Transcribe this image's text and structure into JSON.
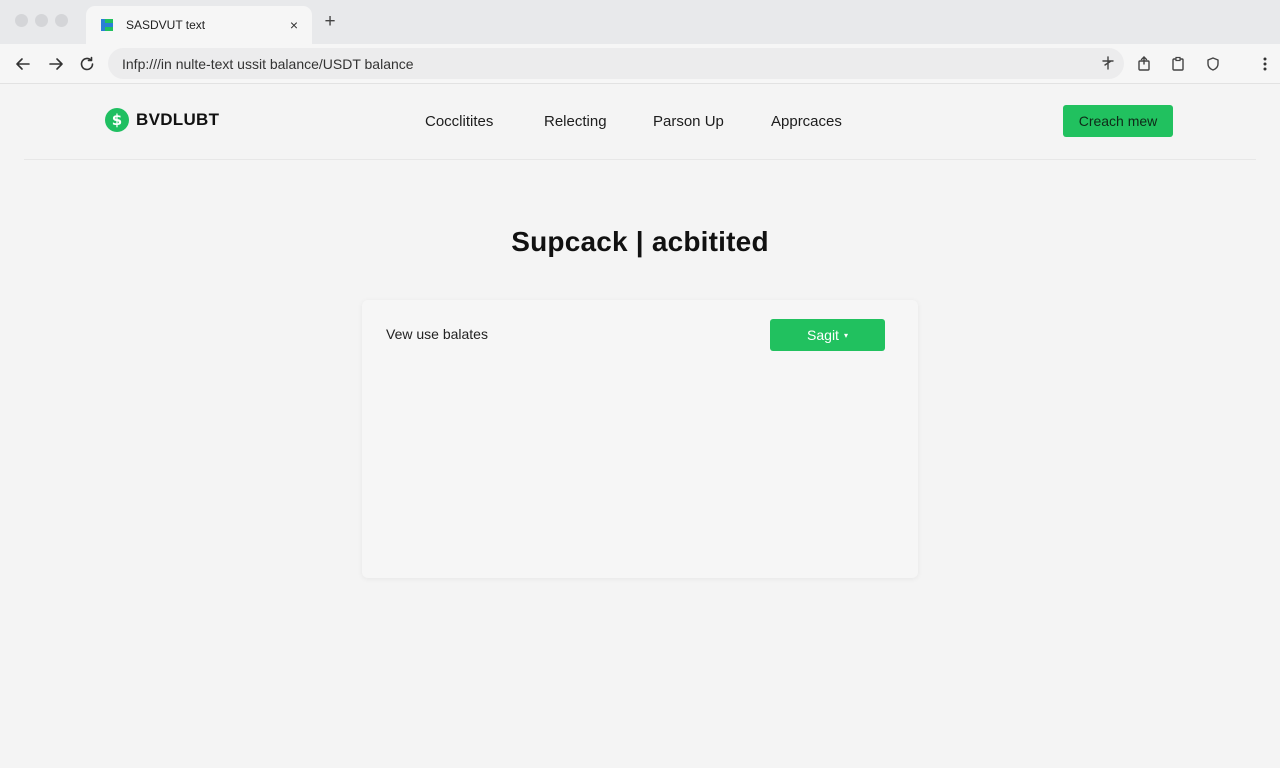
{
  "browser": {
    "tab_title": "SASDVUT text",
    "address": "Infp:///in nulte-text ussit balance/USDT balance",
    "close_glyph": "×",
    "new_tab_glyph": "+"
  },
  "header": {
    "logo_glyph": "$",
    "logo_text": "BVDLUBT",
    "nav": [
      {
        "label": "Cocclitites"
      },
      {
        "label": "Relecting"
      },
      {
        "label": "Parson Up"
      },
      {
        "label": "Apprсaces"
      }
    ],
    "cta_label": "Creach mew"
  },
  "main": {
    "title": "Supcack | acbitited",
    "card": {
      "label": "Vew use balates",
      "button_label": "Sagit",
      "button_caret": "▾"
    }
  },
  "colors": {
    "accent": "#21c15f",
    "background": "#f4f4f4"
  }
}
